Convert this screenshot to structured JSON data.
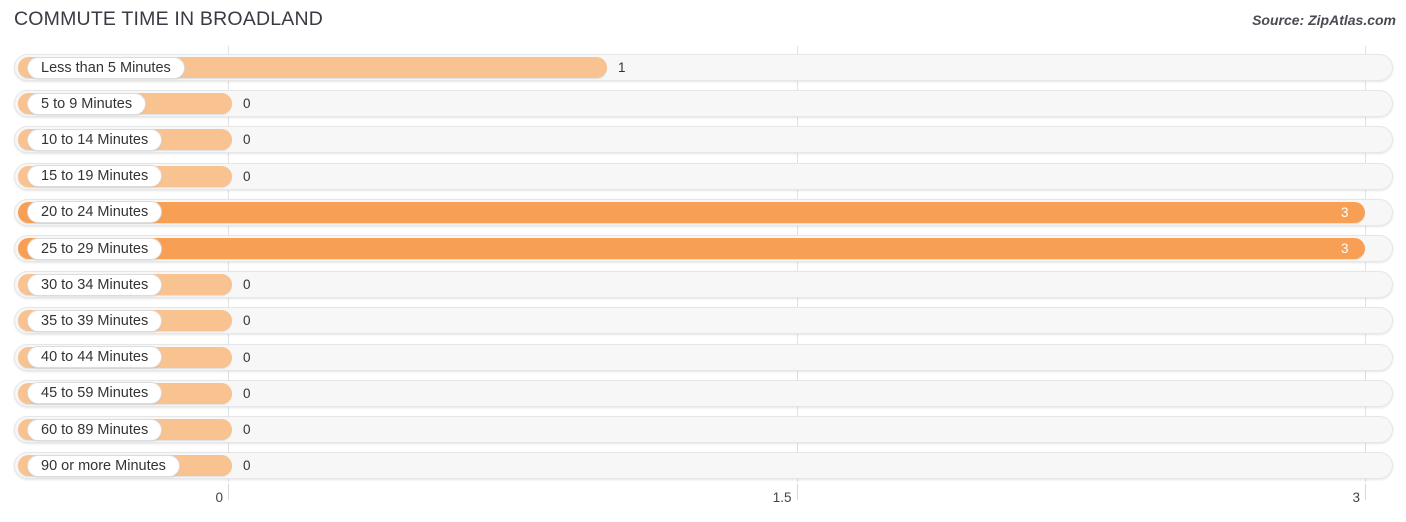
{
  "header": {
    "title": "COMMUTE TIME IN BROADLAND",
    "source": "Source: ZipAtlas.com"
  },
  "colors": {
    "bar_light": "#f8c291",
    "bar_strong": "#f7a055",
    "track_bg": "#f7f7f7",
    "track_border": "#e6e6e6",
    "gridline": "#e2e2e2",
    "label_text": "#333333",
    "value_inside_text": "#ffffff"
  },
  "chart_data": {
    "type": "bar",
    "orientation": "horizontal",
    "title": "COMMUTE TIME IN BROADLAND",
    "xlabel": "",
    "ylabel": "",
    "xlim": [
      0,
      3
    ],
    "grid": true,
    "legend": "none",
    "x_ticks": [
      "0",
      "1.5",
      "3"
    ],
    "x_tick_values": [
      0,
      1.5,
      3
    ],
    "categories": [
      "Less than 5 Minutes",
      "5 to 9 Minutes",
      "10 to 14 Minutes",
      "15 to 19 Minutes",
      "20 to 24 Minutes",
      "25 to 29 Minutes",
      "30 to 34 Minutes",
      "35 to 39 Minutes",
      "40 to 44 Minutes",
      "45 to 59 Minutes",
      "60 to 89 Minutes",
      "90 or more Minutes"
    ],
    "values": [
      1,
      0,
      0,
      0,
      3,
      3,
      0,
      0,
      0,
      0,
      0,
      0
    ],
    "value_labels": [
      "1",
      "0",
      "0",
      "0",
      "3",
      "3",
      "0",
      "0",
      "0",
      "0",
      "0",
      "0"
    ]
  },
  "rows": [
    {
      "label": "Less than 5 Minutes",
      "value": 1,
      "value_label": "1"
    },
    {
      "label": "5 to 9 Minutes",
      "value": 0,
      "value_label": "0"
    },
    {
      "label": "10 to 14 Minutes",
      "value": 0,
      "value_label": "0"
    },
    {
      "label": "15 to 19 Minutes",
      "value": 0,
      "value_label": "0"
    },
    {
      "label": "20 to 24 Minutes",
      "value": 3,
      "value_label": "3"
    },
    {
      "label": "25 to 29 Minutes",
      "value": 3,
      "value_label": "3"
    },
    {
      "label": "30 to 34 Minutes",
      "value": 0,
      "value_label": "0"
    },
    {
      "label": "35 to 39 Minutes",
      "value": 0,
      "value_label": "0"
    },
    {
      "label": "40 to 44 Minutes",
      "value": 0,
      "value_label": "0"
    },
    {
      "label": "45 to 59 Minutes",
      "value": 0,
      "value_label": "0"
    },
    {
      "label": "60 to 89 Minutes",
      "value": 0,
      "value_label": "0"
    },
    {
      "label": "90 or more Minutes",
      "value": 0,
      "value_label": "0"
    }
  ]
}
